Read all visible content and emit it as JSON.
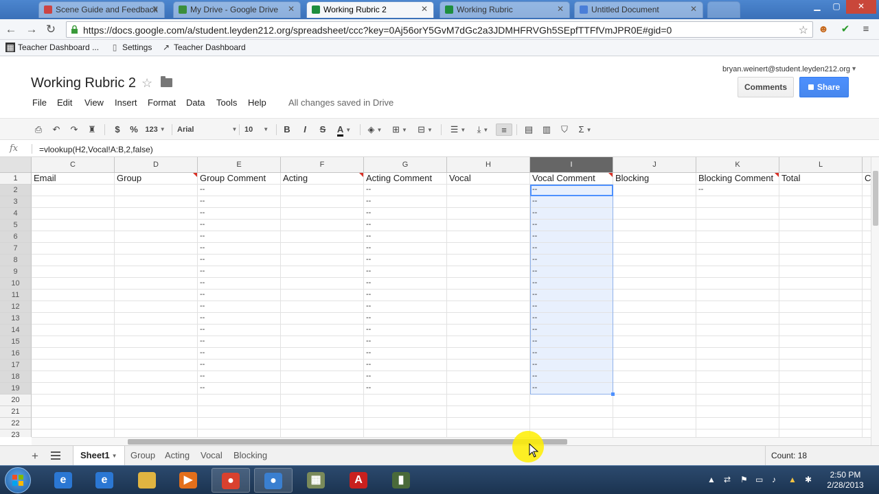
{
  "browser": {
    "tabs": [
      {
        "label": "Scene Guide and Feedback",
        "icon_color": "#c44",
        "active": false
      },
      {
        "label": "My Drive - Google Drive",
        "icon_color": "#3b8e3b",
        "active": false
      },
      {
        "label": "Working Rubric 2",
        "icon_color": "#1e8e3e",
        "active": true
      },
      {
        "label": "Working Rubric",
        "icon_color": "#1e8e3e",
        "active": false
      },
      {
        "label": "Untitled Document",
        "icon_color": "#4a7ed8",
        "active": false
      }
    ],
    "url": "https://docs.google.com/a/student.leyden212.org/spreadsheet/ccc?key=0Aj56orY5GvM7dGc2a3JDMHFRVGh5SEpfTTFfVmJPR0E#gid=0",
    "bookmarks": [
      "Teacher Dashboard ...",
      "Settings",
      "Teacher Dashboard"
    ]
  },
  "doc": {
    "title": "Working Rubric 2",
    "account": "bryan.weinert@student.leyden212.org",
    "comments_label": "Comments",
    "share_label": "Share",
    "menus": [
      "File",
      "Edit",
      "View",
      "Insert",
      "Format",
      "Data",
      "Tools",
      "Help"
    ],
    "save_status": "All changes saved in Drive"
  },
  "toolbar": {
    "currency": "$",
    "percent": "%",
    "number_format": "123",
    "font": "Arial",
    "font_size": "10",
    "bold": "B",
    "italic": "I",
    "strike": "S",
    "text_color": "A"
  },
  "formula_bar": {
    "fx_label": "fx",
    "formula": "=vlookup(H2,Vocal!A:B,2,false)"
  },
  "grid": {
    "columns": [
      "C",
      "D",
      "E",
      "F",
      "G",
      "H",
      "I",
      "J",
      "K",
      "L"
    ],
    "selected_column": "I",
    "header_row": [
      "Email",
      "Group",
      "Group Comment",
      "Acting",
      "Acting Comment",
      "Vocal",
      "Vocal Comment",
      "Blocking",
      "Blocking Comment",
      "Total",
      "C"
    ],
    "rows": [
      "1",
      "2",
      "3",
      "4",
      "5",
      "6",
      "7",
      "8",
      "9",
      "10",
      "11",
      "12",
      "13",
      "14",
      "15",
      "16",
      "17",
      "18",
      "19",
      "20",
      "21",
      "22",
      "23"
    ],
    "selected_rows": [
      "2",
      "3",
      "4",
      "5",
      "6",
      "7",
      "8",
      "9",
      "10",
      "11",
      "12",
      "13",
      "14",
      "15",
      "16",
      "17",
      "18",
      "19"
    ],
    "dash": "--",
    "note_columns": [
      "D",
      "F",
      "I",
      "K"
    ],
    "active_cell": "I2"
  },
  "sheets": {
    "tabs": [
      "Sheet1",
      "Group",
      "Acting",
      "Vocal",
      "Blocking"
    ],
    "active": "Sheet1",
    "count_label": "Count: 18"
  },
  "taskbar": {
    "time": "2:50 PM",
    "date": "2/28/2013",
    "apps": [
      {
        "name": "internet-explorer",
        "color": "#2b77d3",
        "glyph": "e"
      },
      {
        "name": "internet-explorer",
        "color": "#2b77d3",
        "glyph": "e"
      },
      {
        "name": "file-explorer",
        "color": "#e0b441",
        "glyph": ""
      },
      {
        "name": "media-player",
        "color": "#e36f1b",
        "glyph": "▶"
      },
      {
        "name": "chrome",
        "color": "#d9412f",
        "glyph": "●"
      },
      {
        "name": "chrome",
        "color": "#3a7fd0",
        "glyph": "●"
      },
      {
        "name": "app",
        "color": "#7a8a5a",
        "glyph": "▦"
      },
      {
        "name": "acrobat",
        "color": "#c9201e",
        "glyph": "A"
      },
      {
        "name": "app",
        "color": "#4a6a3a",
        "glyph": "▮"
      }
    ]
  },
  "colors": {
    "accent": "#4d90fe",
    "selection_fill": "#e8f0fd",
    "note_marker": "#d93025"
  }
}
